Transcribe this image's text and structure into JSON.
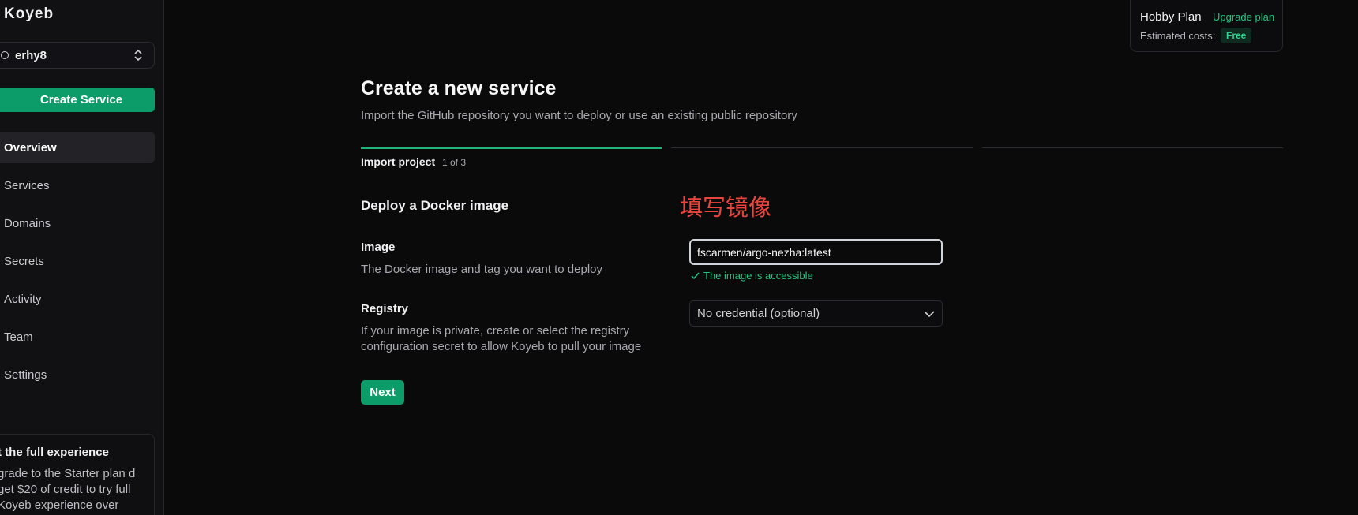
{
  "sidebar": {
    "logo": "Koyeb",
    "org_name": "erhy8",
    "create_button": "Create Service",
    "nav": [
      {
        "label": "Overview",
        "active": true
      },
      {
        "label": "Services"
      },
      {
        "label": "Domains"
      },
      {
        "label": "Secrets"
      },
      {
        "label": "Activity"
      },
      {
        "label": "Team"
      },
      {
        "label": "Settings"
      }
    ],
    "promo": {
      "title": "t the full experience",
      "text": "grade to the Starter plan d get $20 of credit to try full Koyeb experience over"
    }
  },
  "plan": {
    "name": "Hobby Plan",
    "upgrade_link": "Upgrade plan",
    "cost_label": "Estimated costs:",
    "cost_value": "Free"
  },
  "page": {
    "title": "Create a new service",
    "subtitle": "Import the GitHub repository you want to deploy or use an existing public repository",
    "step_label": "Import project",
    "step_count": "1 of 3",
    "step_progress": "1/3"
  },
  "form": {
    "section_title": "Deploy a Docker image",
    "annotation": "填写镜像",
    "image": {
      "label": "Image",
      "help": "The Docker image and tag you want to deploy",
      "value": "fscarmen/argo-nezha:latest",
      "status": "The image is accessible"
    },
    "registry": {
      "label": "Registry",
      "help": "If your image is private, create or select the registry configuration secret to allow Koyeb to pull your image",
      "selected": "No credential (optional)"
    },
    "next_button": "Next"
  },
  "colors": {
    "accent": "#0b9c6a",
    "success": "#23c483",
    "annotation": "#e8463c"
  }
}
